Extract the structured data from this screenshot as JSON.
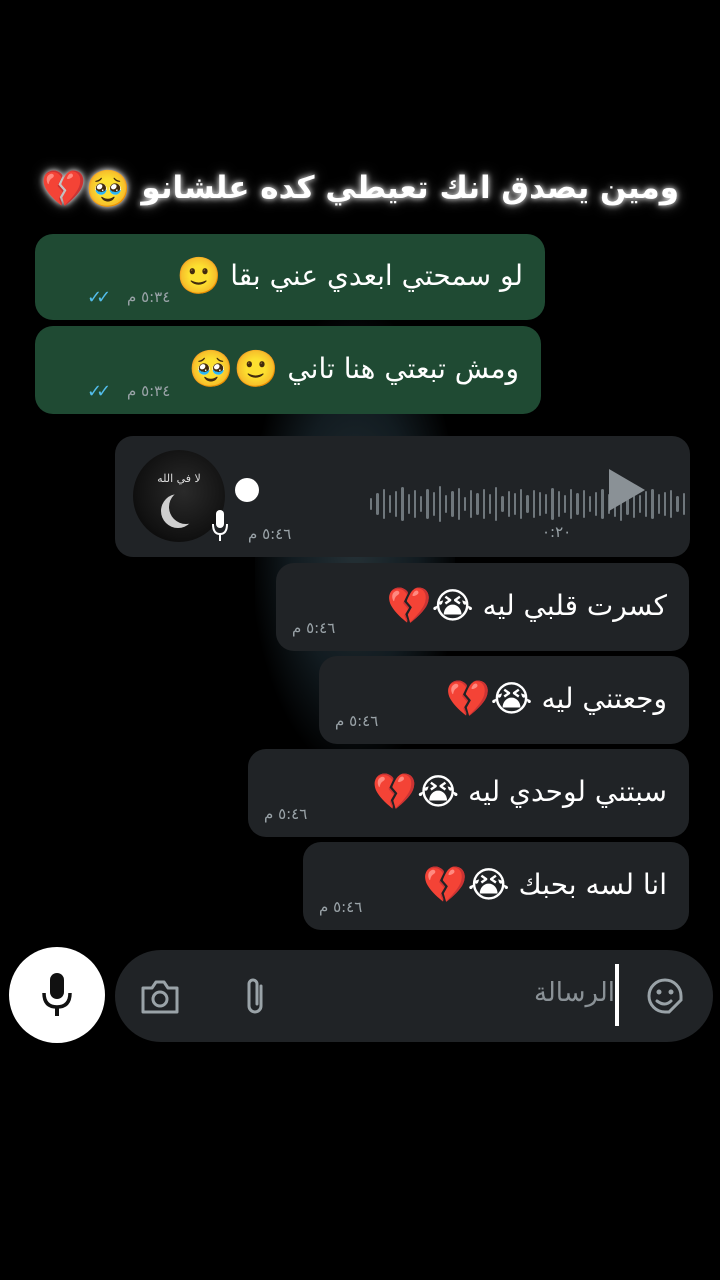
{
  "caption": {
    "text": "ومين يصدق انك تعيطي كده علشانو",
    "emojis": "🥹💔"
  },
  "messages": [
    {
      "kind": "outgoing",
      "text": "لو سمحتي ابعدي عني بقا",
      "emoji": "🙂",
      "time": "٥:٣٤ م",
      "status": "read"
    },
    {
      "kind": "outgoing",
      "text": "ومش تبعتي هنا تاني",
      "emoji": "🙂🥹",
      "time": "٥:٣٤ م",
      "status": "read"
    },
    {
      "kind": "incoming-voice",
      "duration": "٠:٢٠",
      "time": "٥:٤٦ م",
      "avatar_text": "لا في الله"
    },
    {
      "kind": "incoming",
      "text": "كسرت قلبي ليه",
      "emoji": "😭💔",
      "time": "٥:٤٦ م"
    },
    {
      "kind": "incoming",
      "text": "وجعتني ليه",
      "emoji": "😭💔",
      "time": "٥:٤٦ م"
    },
    {
      "kind": "incoming",
      "text": "سبتني لوحدي ليه",
      "emoji": "😭💔",
      "time": "٥:٤٦ م"
    },
    {
      "kind": "incoming",
      "text": "انا لسه بحبك",
      "emoji": "😭💔",
      "time": "٥:٤٦ م"
    }
  ],
  "composer": {
    "placeholder": "الرسالة"
  },
  "icons": {
    "camera": "camera-icon",
    "attach": "paperclip-icon",
    "sticker": "sticker-icon",
    "mic": "microphone-icon",
    "play": "play-icon",
    "ticks": "double-check-icon"
  },
  "colors": {
    "outgoing_bubble": "#1f4a33",
    "incoming_bubble": "#202326",
    "read_ticks": "#53bdeb",
    "background": "#000000"
  }
}
